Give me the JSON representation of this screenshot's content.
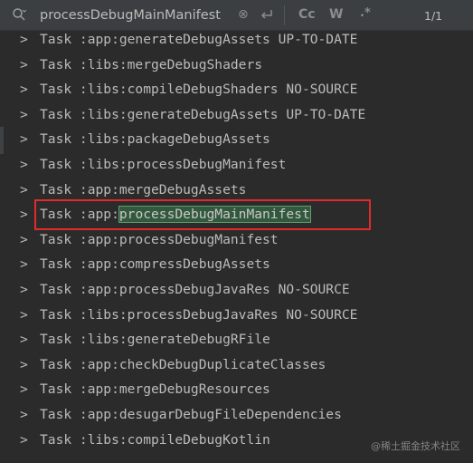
{
  "search": {
    "query": "processDebugMainManifest",
    "clear_glyph": "⊗",
    "match_case": "Cc",
    "whole_word": "W",
    "regex": ".*",
    "counter": "1/1"
  },
  "log": {
    "prompt": ">",
    "lines": [
      {
        "pre": "Task :app:generateDebugAssets UP-TO-DATE"
      },
      {
        "pre": "Task :libs:mergeDebugShaders"
      },
      {
        "pre": "Task :libs:compileDebugShaders NO-SOURCE"
      },
      {
        "pre": "Task :libs:generateDebugAssets UP-TO-DATE"
      },
      {
        "pre": "Task :libs:packageDebugAssets"
      },
      {
        "pre": "Task :libs:processDebugManifest"
      },
      {
        "pre": "Task :app:mergeDebugAssets"
      },
      {
        "pre": "Task :app:",
        "match": "processDebugMainManifest"
      },
      {
        "pre": "Task :app:processDebugManifest"
      },
      {
        "pre": "Task :app:compressDebugAssets"
      },
      {
        "pre": "Task :app:processDebugJavaRes NO-SOURCE"
      },
      {
        "pre": "Task :libs:processDebugJavaRes NO-SOURCE"
      },
      {
        "pre": "Task :libs:generateDebugRFile"
      },
      {
        "pre": "Task :app:checkDebugDuplicateClasses"
      },
      {
        "pre": "Task :app:mergeDebugResources"
      },
      {
        "pre": "Task :app:desugarDebugFileDependencies"
      },
      {
        "pre": "Task :libs:compileDebugKotlin"
      }
    ]
  },
  "watermark": "@稀土掘金技术社区"
}
